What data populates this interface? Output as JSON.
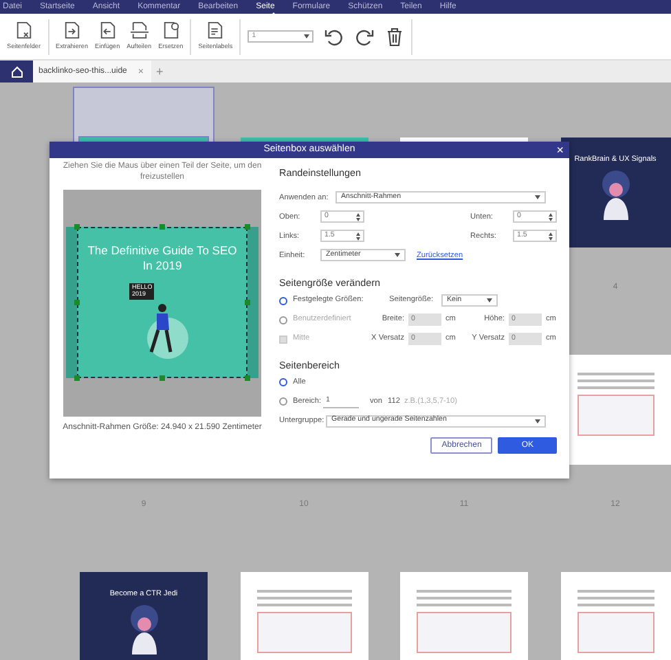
{
  "menu": [
    {
      "label": "Datei",
      "selected": false
    },
    {
      "label": "Startseite",
      "selected": false
    },
    {
      "label": "Ansicht",
      "selected": false
    },
    {
      "label": "Kommentar",
      "selected": false
    },
    {
      "label": "Bearbeiten",
      "selected": false
    },
    {
      "label": "Seite",
      "selected": true
    },
    {
      "label": "Formulare",
      "selected": false
    },
    {
      "label": "Schützen",
      "selected": false
    },
    {
      "label": "Teilen",
      "selected": false
    },
    {
      "label": "Hilfe",
      "selected": false
    }
  ],
  "toolbar": {
    "groups": [
      [
        {
          "label": "Seitenfelder",
          "kind": "boxes"
        }
      ],
      [
        {
          "label": "Extrahieren",
          "kind": "extract"
        },
        {
          "label": "Einfügen",
          "kind": "insert"
        },
        {
          "label": "Aufteilen",
          "kind": "split"
        },
        {
          "label": "Ersetzen",
          "kind": "replace"
        }
      ],
      [
        {
          "label": "Seitenlabels",
          "kind": "labels"
        }
      ]
    ],
    "page_select": {
      "value": "1"
    },
    "actions": [
      {
        "kind": "rotate-left"
      },
      {
        "kind": "rotate-right"
      },
      {
        "kind": "delete"
      }
    ]
  },
  "tabs": {
    "document": {
      "label": "backlinko-seo-this...uide",
      "close": "×",
      "selected": true
    },
    "new_tab": "+"
  },
  "pages": [
    [
      {
        "kind": "cover-teal",
        "selected": true
      },
      {
        "kind": "cover-teal",
        "selected": false
      },
      {
        "kind": "document",
        "selected": false
      },
      {
        "kind": "cover-navy",
        "title": "RankBrain & UX Signals",
        "number": "4",
        "selected": false
      }
    ],
    [
      {
        "number": "9",
        "selected": false
      },
      {
        "number": "10",
        "selected": false
      },
      {
        "number": "11",
        "selected": false
      },
      {
        "kind": "document",
        "number": "12",
        "selected": false
      }
    ],
    [
      {
        "kind": "cover-navy",
        "title": "Become a CTR Jedi",
        "selected": false
      },
      {
        "kind": "document",
        "selected": false
      },
      {
        "kind": "document",
        "selected": false
      },
      {
        "kind": "document",
        "selected": false
      }
    ]
  ],
  "dialog": {
    "title": "Seitenbox auswählen",
    "close": "×",
    "instruction": "Ziehen Sie die Maus über einen Teil der Seite, um den freizustellen",
    "preview": {
      "title": "The Definitive Guide To SEO In 2019",
      "badge": "HELLO 2019",
      "caption": "Anschnitt-Rahmen Größe: 24.940 x 21.590 Zentimeter"
    },
    "margins": {
      "heading": "Randeinstellungen",
      "apply_label": "Anwenden an:",
      "apply_value": "Anschnitt-Rahmen",
      "fields": [
        {
          "label": "Oben:",
          "value": "0"
        },
        {
          "label": "Unten:",
          "value": "0"
        },
        {
          "label": "Links:",
          "value": "1.5"
        },
        {
          "label": "Rechts:",
          "value": "1.5"
        }
      ],
      "unit_label": "Einheit:",
      "unit_value": "Zentimeter",
      "reset": "Zurücksetzen"
    },
    "page_size": {
      "heading": "Seitengröße verändern",
      "fixed": {
        "label": "Festgelegte Größen:",
        "selected": true,
        "size_label": "Seitengröße:",
        "size_value": "Kein"
      },
      "custom": {
        "label": "Benutzerdefiniert",
        "selected": false,
        "fields": [
          {
            "label": "Breite:",
            "value": "0",
            "unit": "cm",
            "disabled": true
          },
          {
            "label": "Höhe:",
            "value": "0",
            "unit": "cm",
            "disabled": true
          }
        ]
      },
      "center": {
        "label": "Mitte",
        "checked": false,
        "disabled": true,
        "fields": [
          {
            "label": "X Versatz",
            "value": "0",
            "unit": "cm",
            "disabled": true
          },
          {
            "label": "Y Versatz",
            "value": "0",
            "unit": "cm",
            "disabled": true
          }
        ]
      }
    },
    "range": {
      "heading": "Seitenbereich",
      "all": {
        "label": "Alle",
        "selected": true
      },
      "custom": {
        "label": "Bereich:",
        "selected": false,
        "value": "1",
        "of": "von",
        "total": "112",
        "hint": "z.B.(1,3,5,7-10)"
      },
      "subset_label": "Untergruppe:",
      "subset_value": "Gerade und ungerade Seitenzahlen"
    },
    "buttons": [
      {
        "label": "Abbrechen",
        "kind": "secondary"
      },
      {
        "label": "OK",
        "kind": "primary"
      }
    ]
  }
}
